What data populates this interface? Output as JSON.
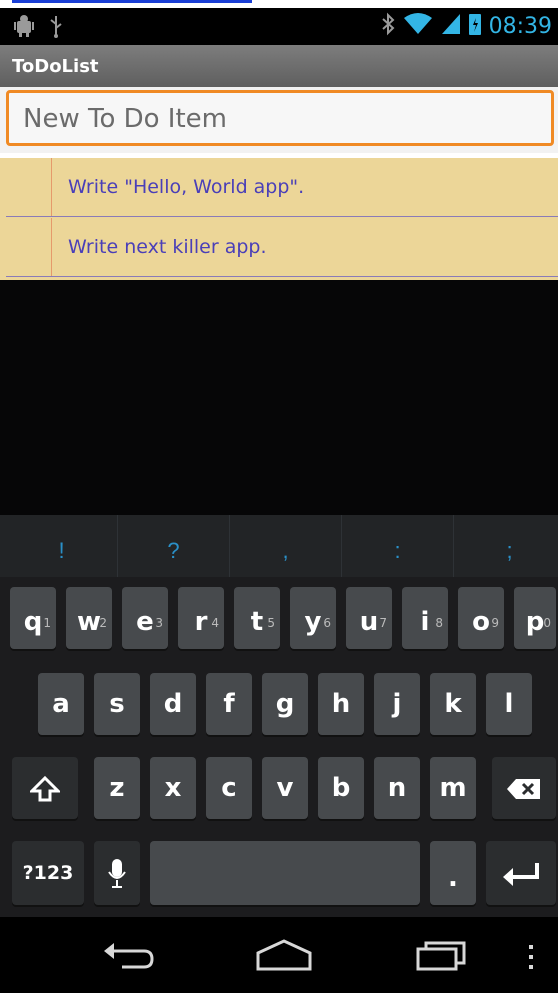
{
  "status_bar": {
    "time": "08:39",
    "left_icons": [
      "android-debug-icon",
      "usb-icon"
    ],
    "right_icons": [
      "bluetooth-icon",
      "wifi-icon",
      "signal-icon",
      "battery-icon"
    ]
  },
  "action_bar": {
    "title": "ToDoList"
  },
  "new_item": {
    "placeholder": "New To Do Item",
    "value": ""
  },
  "todo_items": [
    {
      "text": "Write \"Hello, World app\"."
    },
    {
      "text": "Write next killer app."
    }
  ],
  "keyboard": {
    "suggestions": [
      "!",
      "?",
      ",",
      ":",
      ";"
    ],
    "row1": [
      {
        "key": "q",
        "sup": "1"
      },
      {
        "key": "w",
        "sup": "2"
      },
      {
        "key": "e",
        "sup": "3"
      },
      {
        "key": "r",
        "sup": "4"
      },
      {
        "key": "t",
        "sup": "5"
      },
      {
        "key": "y",
        "sup": "6"
      },
      {
        "key": "u",
        "sup": "7"
      },
      {
        "key": "i",
        "sup": "8"
      },
      {
        "key": "o",
        "sup": "9"
      },
      {
        "key": "p",
        "sup": "0"
      }
    ],
    "row2": [
      "a",
      "s",
      "d",
      "f",
      "g",
      "h",
      "j",
      "k",
      "l"
    ],
    "row3": [
      "z",
      "x",
      "c",
      "v",
      "b",
      "n",
      "m"
    ],
    "symbols_label": "?123",
    "period_label": "."
  },
  "colors": {
    "accent": "#33b5e5",
    "list_background": "#ecd698",
    "list_text": "#4a3fb8",
    "focus_border": "#f08a24"
  }
}
